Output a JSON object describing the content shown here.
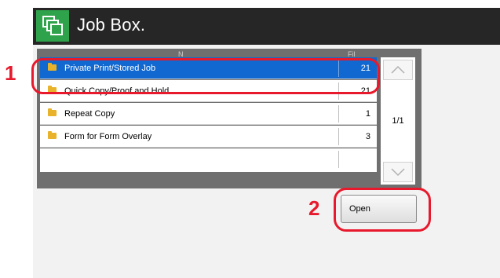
{
  "window": {
    "title": "Job Box."
  },
  "list": {
    "headers": {
      "name": "N",
      "files": "Fil"
    },
    "rows": [
      {
        "name": "Private Print/Stored Job",
        "count": "21",
        "selected": true
      },
      {
        "name": "Quick Copy/Proof and Hold",
        "count": "21",
        "selected": false
      },
      {
        "name": "Repeat Copy",
        "count": "1",
        "selected": false
      },
      {
        "name": "Form for Form Overlay",
        "count": "3",
        "selected": false
      },
      {
        "name": "",
        "count": "",
        "selected": false
      }
    ],
    "page_indicator": "1/1"
  },
  "buttons": {
    "open": "Open"
  },
  "callouts": {
    "step1": "1",
    "step2": "2"
  },
  "colors": {
    "accent_green": "#2fa34b",
    "selection_blue": "#1068d0",
    "callout_red": "#e8192c"
  },
  "icons": [
    "job-box-icon",
    "folder-icon",
    "chevron-up-icon",
    "chevron-down-icon"
  ]
}
